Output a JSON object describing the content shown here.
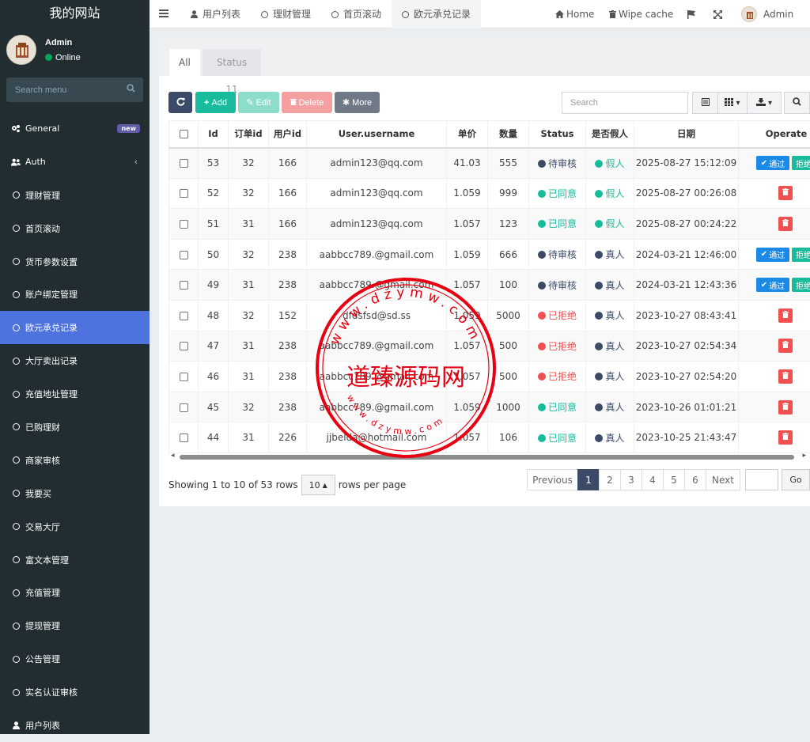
{
  "sidebar": {
    "logo": "我的网站",
    "user": {
      "name": "Admin",
      "status": "Online"
    },
    "search_placeholder": "Search menu",
    "items": [
      {
        "label": "General",
        "icon": "cogs-icon",
        "badge": "new"
      },
      {
        "label": "Auth",
        "icon": "users-icon",
        "chevron": "‹"
      },
      {
        "label": "理财管理",
        "icon": "circle-icon"
      },
      {
        "label": "首页滚动",
        "icon": "circle-icon"
      },
      {
        "label": "货币参数设置",
        "icon": "circle-icon"
      },
      {
        "label": "账户绑定管理",
        "icon": "circle-icon"
      },
      {
        "label": "欧元承兑记录",
        "icon": "circle-icon",
        "active": true
      },
      {
        "label": "大厅卖出记录",
        "icon": "circle-icon"
      },
      {
        "label": "充值地址管理",
        "icon": "circle-icon"
      },
      {
        "label": "已购理财",
        "icon": "circle-icon"
      },
      {
        "label": "商家审核",
        "icon": "circle-icon"
      },
      {
        "label": "我要买",
        "icon": "circle-icon"
      },
      {
        "label": "交易大厅",
        "icon": "circle-icon"
      },
      {
        "label": "富文本管理",
        "icon": "circle-icon"
      },
      {
        "label": "充值管理",
        "icon": "circle-icon"
      },
      {
        "label": "提现管理",
        "icon": "circle-icon"
      },
      {
        "label": "公告管理",
        "icon": "circle-icon"
      },
      {
        "label": "实名认证审核",
        "icon": "circle-icon"
      },
      {
        "label": "用户列表",
        "icon": "user-icon"
      }
    ]
  },
  "topbar": {
    "tabs": [
      {
        "label": "用户列表",
        "icon": "user-icon"
      },
      {
        "label": "理财管理",
        "icon": "circle-icon"
      },
      {
        "label": "首页滚动",
        "icon": "circle-icon"
      },
      {
        "label": "欧元承兑记录",
        "icon": "circle-icon",
        "active": true
      }
    ],
    "home": "Home",
    "wipe_cache": "Wipe cache",
    "admin": "Admin"
  },
  "content": {
    "tab_all": "All",
    "tab_status": "Status 11",
    "toolbar": {
      "add": "Add",
      "edit": "Edit",
      "delete": "Delete",
      "more": "More"
    },
    "search_placeholder": "Search",
    "table": {
      "headers": [
        "Id",
        "订单id",
        "用户id",
        "User.username",
        "单价",
        "数量",
        "Status",
        "是否假人",
        "日期",
        "Operate"
      ],
      "rows": [
        {
          "id": "53",
          "order": "32",
          "uid": "166",
          "user": "admin123@qq.com",
          "price": "41.03",
          "qty": "555",
          "status": "待审核",
          "fake": "假人",
          "date": "2025-08-27 15:12:09",
          "ops": [
            "通过",
            "拒绝"
          ]
        },
        {
          "id": "52",
          "order": "32",
          "uid": "166",
          "user": "admin123@qq.com",
          "price": "1.059",
          "qty": "999",
          "status": "已同意",
          "fake": "假人",
          "date": "2025-08-27 00:26:08",
          "ops": []
        },
        {
          "id": "51",
          "order": "31",
          "uid": "166",
          "user": "admin123@qq.com",
          "price": "1.057",
          "qty": "123",
          "status": "已同意",
          "fake": "假人",
          "date": "2025-08-27 00:24:22",
          "ops": []
        },
        {
          "id": "50",
          "order": "32",
          "uid": "238",
          "user": "aabbcc789.@gmail.com",
          "price": "1.059",
          "qty": "666",
          "status": "待审核",
          "fake": "真人",
          "date": "2024-03-21 12:46:00",
          "ops": [
            "通过",
            "拒绝"
          ]
        },
        {
          "id": "49",
          "order": "31",
          "uid": "238",
          "user": "aabbcc789.@gmail.com",
          "price": "1.057",
          "qty": "100",
          "status": "待审核",
          "fake": "真人",
          "date": "2024-03-21 12:43:36",
          "ops": [
            "通过",
            "拒绝"
          ]
        },
        {
          "id": "48",
          "order": "32",
          "uid": "152",
          "user": "dfdsfsd@sd.ss",
          "price": "1.059",
          "qty": "5000",
          "status": "已拒绝",
          "fake": "真人",
          "date": "2023-10-27 08:43:41",
          "ops": []
        },
        {
          "id": "47",
          "order": "31",
          "uid": "238",
          "user": "aabbcc789.@gmail.com",
          "price": "1.057",
          "qty": "500",
          "status": "已拒绝",
          "fake": "真人",
          "date": "2023-10-27 02:54:34",
          "ops": []
        },
        {
          "id": "46",
          "order": "31",
          "uid": "238",
          "user": "aabbcc789.@gmail.com",
          "price": "1.057",
          "qty": "500",
          "status": "已拒绝",
          "fake": "真人",
          "date": "2023-10-27 02:54:20",
          "ops": []
        },
        {
          "id": "45",
          "order": "32",
          "uid": "238",
          "user": "aabbcc789.@gmail.com",
          "price": "1.059",
          "qty": "1000",
          "status": "已同意",
          "fake": "真人",
          "date": "2023-10-26 01:01:21",
          "ops": []
        },
        {
          "id": "44",
          "order": "31",
          "uid": "226",
          "user": "jjbelda@hotmail.com",
          "price": "1.057",
          "qty": "106",
          "status": "已同意",
          "fake": "真人",
          "date": "2023-10-25 21:43:47",
          "ops": []
        }
      ]
    },
    "pagination": {
      "showing": "Showing 1 to 10 of 53 rows",
      "page_size": "10",
      "rows_per_page": "rows per page",
      "previous": "Previous",
      "pages": [
        "1",
        "2",
        "3",
        "4",
        "5",
        "6"
      ],
      "next": "Next",
      "go": "Go"
    }
  },
  "watermark": {
    "text": "道臻源码网",
    "url": "www.dzymw.com"
  },
  "colors": {
    "sidebar_bg": "#222d32",
    "active_menu": "#4e73df",
    "status_pending": "#3c4a67",
    "status_agreed": "#18bc9c",
    "status_rejected": "#f05050",
    "btn_add": "#18bc9c",
    "btn_pass": "#1a8ae6"
  }
}
